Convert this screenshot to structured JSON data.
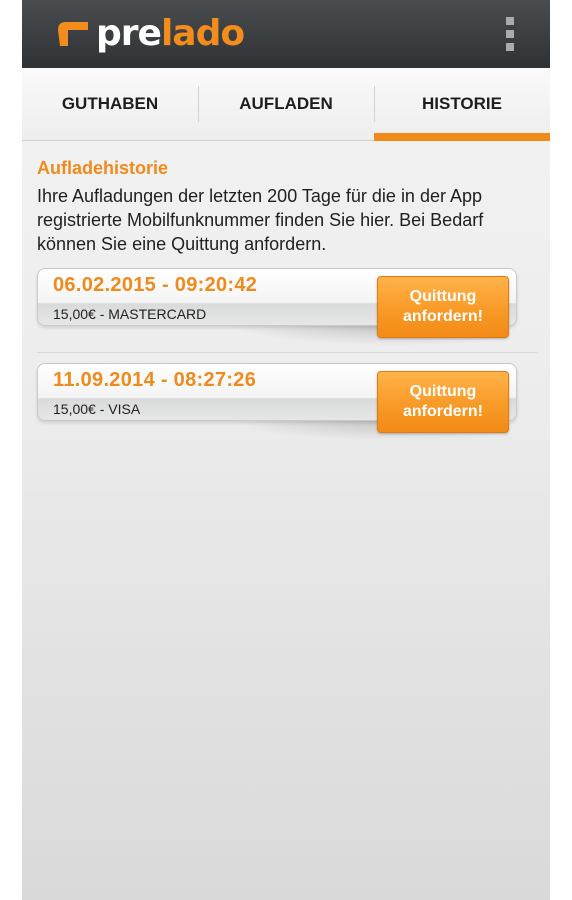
{
  "header": {
    "logo_pre": "pre",
    "logo_lado": "lado"
  },
  "tabs": [
    {
      "label": "GUTHABEN",
      "active": false
    },
    {
      "label": "AUFLADEN",
      "active": false
    },
    {
      "label": "HISTORIE",
      "active": true
    }
  ],
  "history": {
    "title": "Aufladehistorie",
    "intro": "Ihre Aufladungen der letzten 200 Tage für die in der App registrierte Mobilfunknummer finden Sie hier. Bei Bedarf können Sie eine Quittung anfordern.",
    "entries": [
      {
        "datetime": "06.02.2015 - 09:20:42",
        "detail": "15,00€ - MASTERCARD",
        "button_label": "Quittung\nanfordern!"
      },
      {
        "datetime": "11.09.2014 - 08:27:26",
        "detail": "15,00€ - VISA",
        "button_label": "Quittung\nanfordern!"
      }
    ]
  },
  "colors": {
    "accent": "#ef8a1b",
    "header_bg": "#3a3d40"
  },
  "icons": {
    "menu": "overflow-menu-icon",
    "logo": "prelado-logo-mark"
  }
}
